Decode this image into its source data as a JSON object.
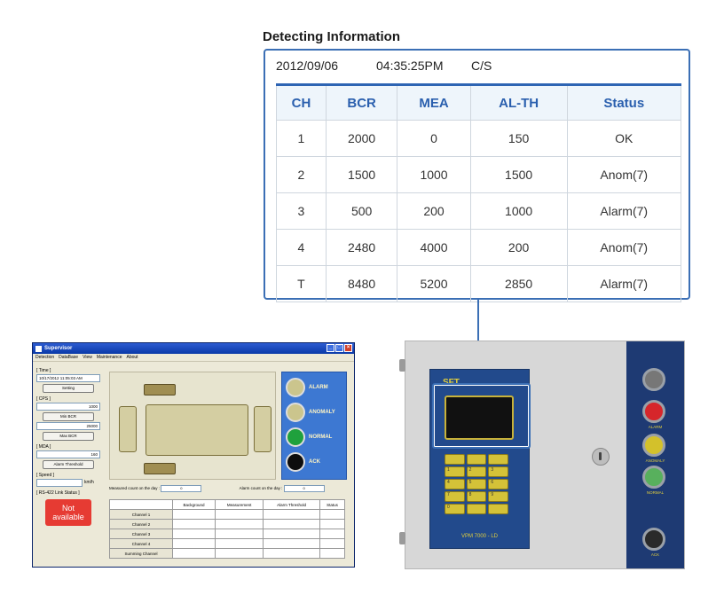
{
  "detecting_info": {
    "title": "Detecting Information",
    "date": "2012/09/06",
    "time": "04:35:25PM",
    "mode": "C/S",
    "columns": [
      "CH",
      "BCR",
      "MEA",
      "AL-TH",
      "Status"
    ],
    "rows": [
      [
        "1",
        "2000",
        "0",
        "150",
        "OK"
      ],
      [
        "2",
        "1500",
        "1000",
        "1500",
        "Anom(7)"
      ],
      [
        "3",
        "500",
        "200",
        "1000",
        "Alarm(7)"
      ],
      [
        "4",
        "2480",
        "4000",
        "200",
        "Anom(7)"
      ],
      [
        "T",
        "8480",
        "5200",
        "2850",
        "Alarm(7)"
      ]
    ]
  },
  "supervisor": {
    "window_title": "Supervisor",
    "menu": [
      "Detection",
      "DataBase",
      "View",
      "Maintenance",
      "About"
    ],
    "time_group": "[ Time ]",
    "time_value": "10/17/2012 11:05:03 AM",
    "setting_button": "Setting",
    "cps_group": "[ CPS ]",
    "min_value": "1000",
    "min_button": "Min BCR",
    "max_value": "25000",
    "max_button": "Max BCR",
    "mda_group": "[ MDA ]",
    "mda_value": "160",
    "alarm_threshold_button": "Alarm Threshold",
    "speed_group": "[ Speed ]",
    "speed_unit": "km/h",
    "link_group": "[ RS-422 Link Status ]",
    "link_status": "Not available",
    "status_labels": [
      "ALARM",
      "ANOMALY",
      "NORMAL",
      "ACK"
    ],
    "measured_label": "Measured count on the day :",
    "measured_value": "0",
    "alarm_count_label": "Alarm count on the day :",
    "alarm_count_value": "0",
    "table_headers": [
      "",
      "Background",
      "Measurement",
      "Alarm Threshold",
      "Status"
    ],
    "table_rows": [
      "Channel 1",
      "Channel 2",
      "Channel 3",
      "Channel 4",
      "Summing Channel"
    ]
  },
  "device": {
    "logo": "SFT",
    "model": "VPM 7000 - LD",
    "keys": [
      "",
      "",
      "",
      "1",
      "2",
      "3",
      "4",
      "5",
      "6",
      "7",
      "8",
      "9",
      "0",
      "",
      ""
    ],
    "side_labels": [
      "ALARM",
      "ANOMALY",
      "NORMAL",
      "ACK"
    ]
  },
  "colors": {
    "accent_blue": "#2d64b3",
    "header_fill": "#eef5fb",
    "alarm_red": "#e63b33",
    "status_panel": "#3d78d2",
    "device_navy": "#1e3a73",
    "key_yellow": "#d4c238"
  }
}
